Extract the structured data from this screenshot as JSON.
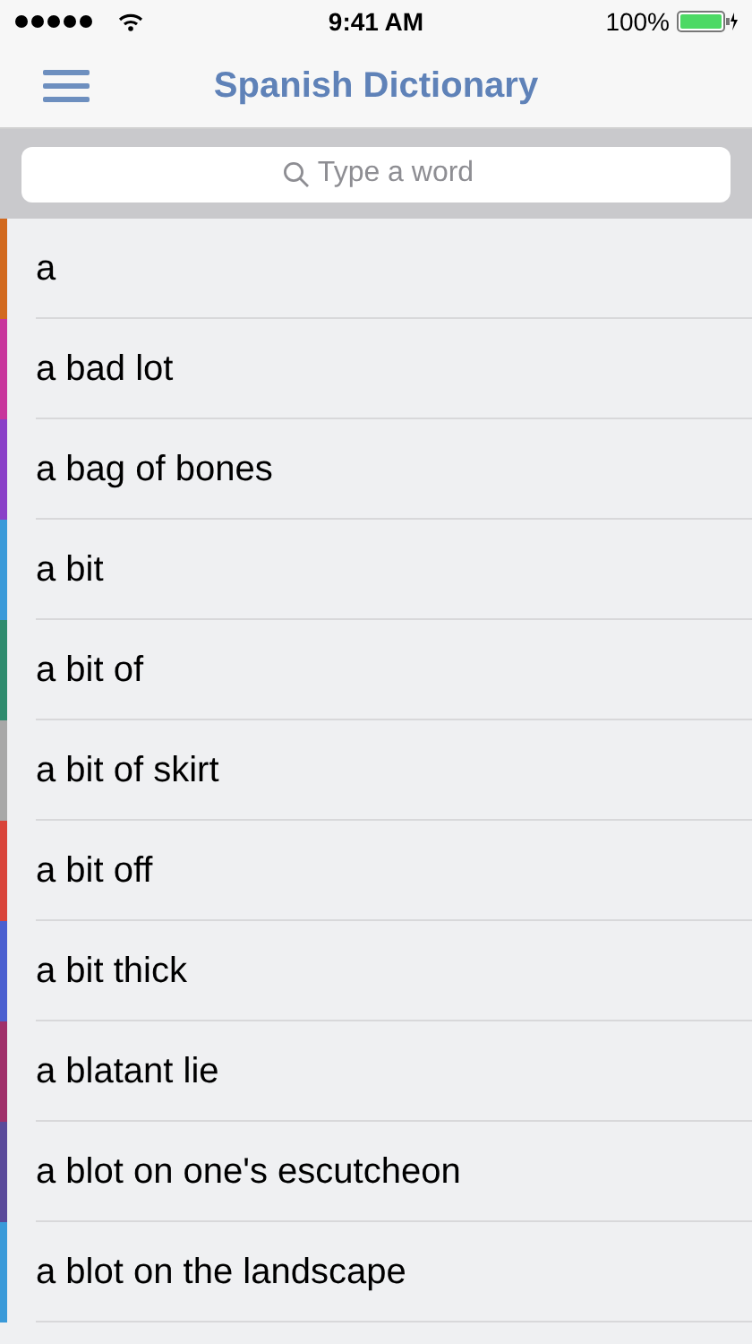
{
  "status_bar": {
    "time": "9:41 AM",
    "battery": "100%"
  },
  "header": {
    "title": "Spanish Dictionary"
  },
  "search": {
    "placeholder": "Type a word"
  },
  "entries": [
    {
      "word": "a",
      "color": "#d2691e"
    },
    {
      "word": "a bad lot",
      "color": "#c8359c"
    },
    {
      "word": "a bag of bones",
      "color": "#8a3fc8"
    },
    {
      "word": "a bit",
      "color": "#3a9ad9"
    },
    {
      "word": "a bit of",
      "color": "#2e8b6e"
    },
    {
      "word": "a bit of skirt",
      "color": "#a8a8a8"
    },
    {
      "word": "a bit off",
      "color": "#d9443a"
    },
    {
      "word": "a bit thick",
      "color": "#4a5fd0"
    },
    {
      "word": "a blatant lie",
      "color": "#a0306a"
    },
    {
      "word": "a blot on one's escutcheon",
      "color": "#5a4a9a"
    },
    {
      "word": "a blot on the landscape",
      "color": "#3a9ad9"
    }
  ]
}
